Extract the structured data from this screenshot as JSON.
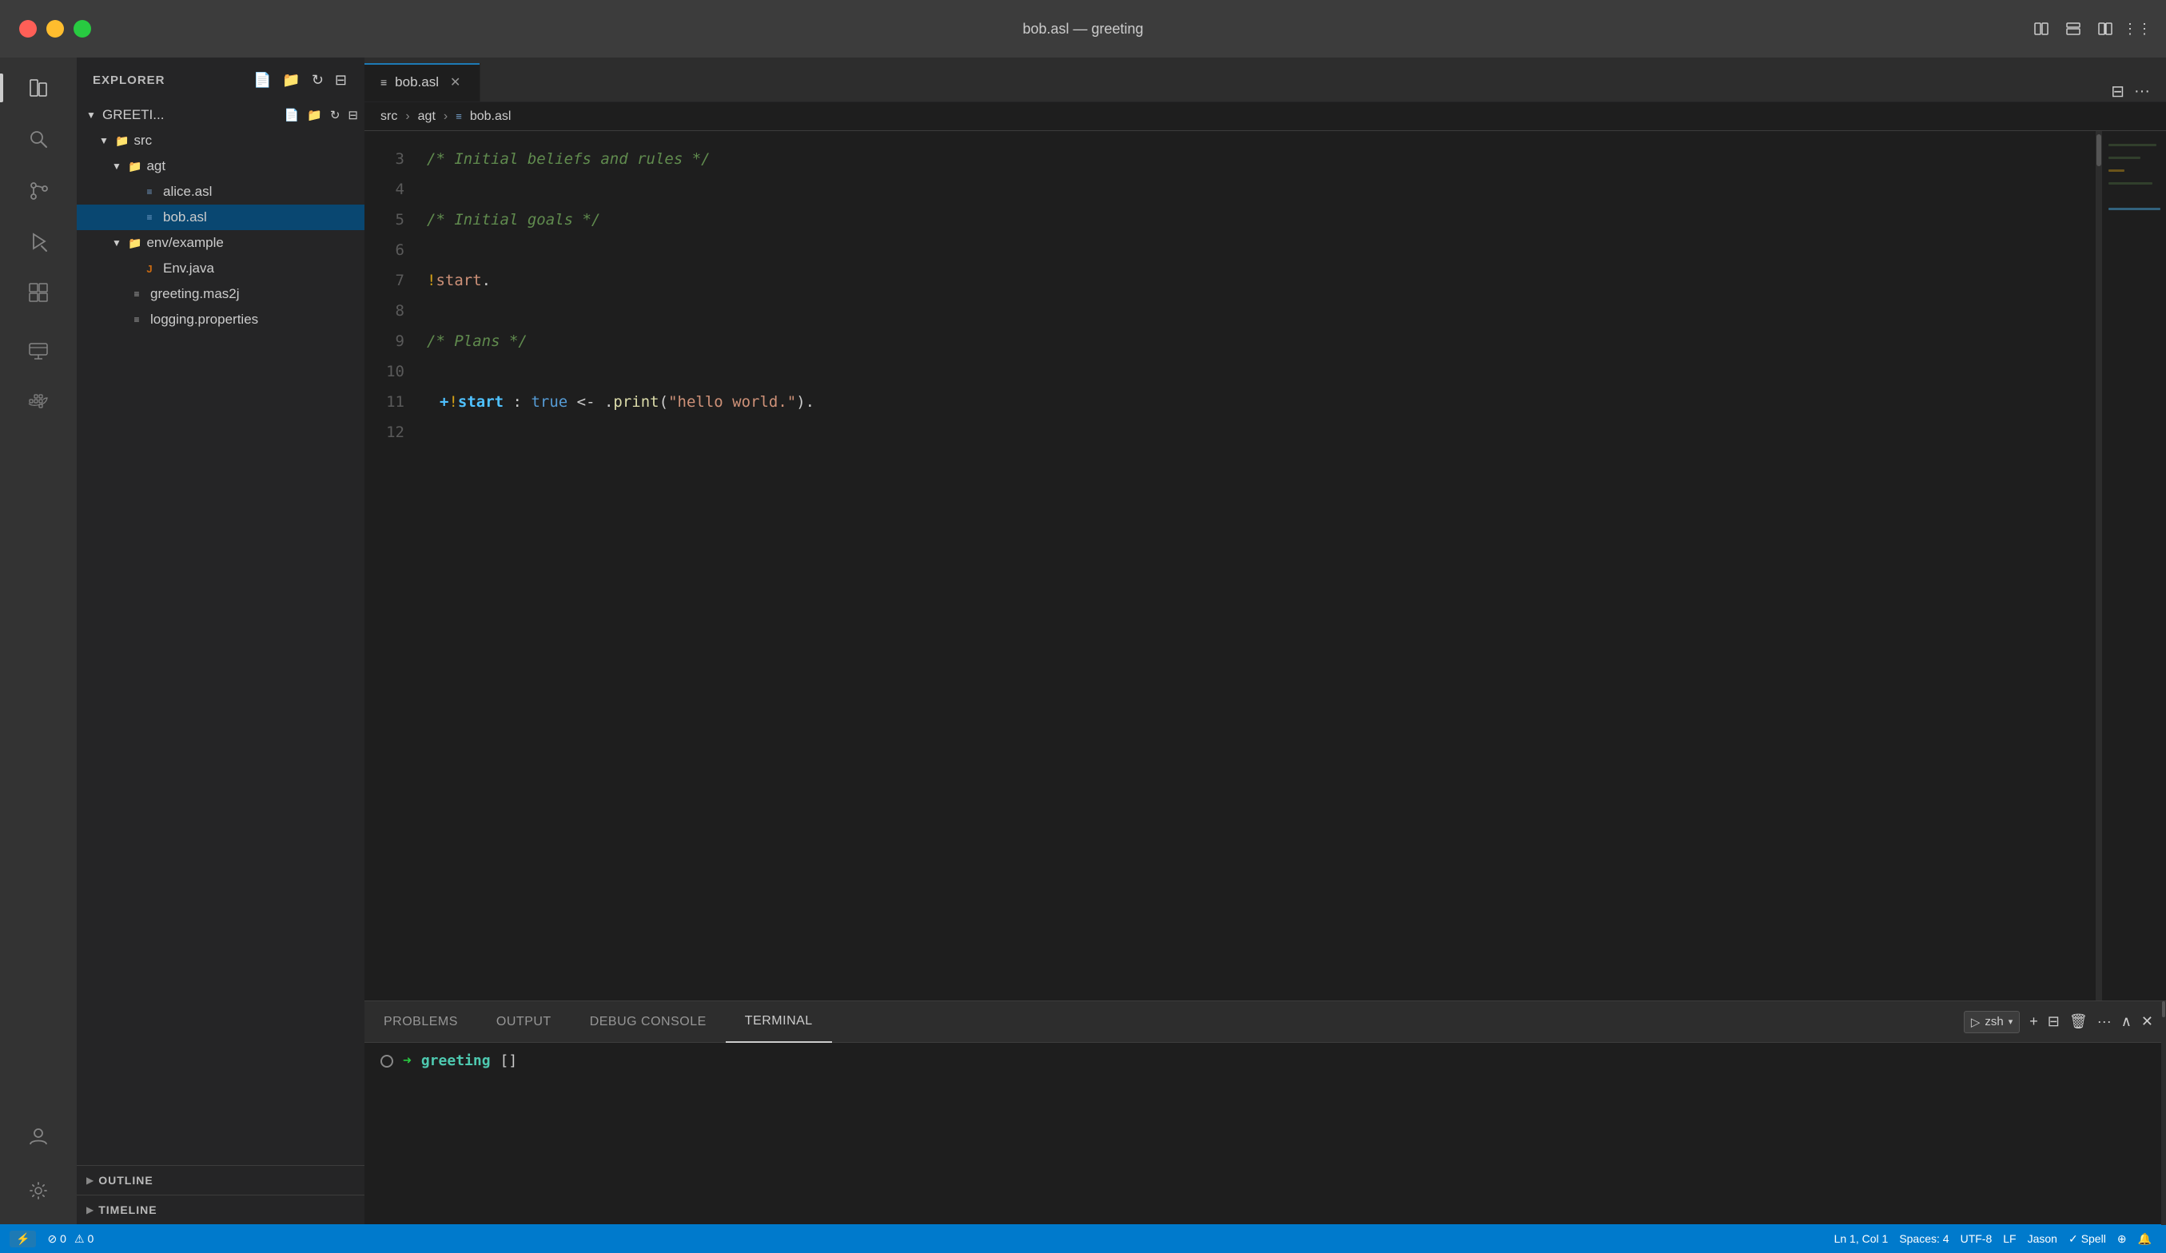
{
  "window": {
    "title": "bob.asl — greeting"
  },
  "titlebar": {
    "actions": [
      "layout-icon",
      "layout2-icon",
      "split-icon",
      "more-icon"
    ]
  },
  "activity_bar": {
    "items": [
      {
        "id": "explorer",
        "icon": "📄",
        "label": "Explorer",
        "active": true
      },
      {
        "id": "search",
        "icon": "🔍",
        "label": "Search",
        "active": false
      },
      {
        "id": "source-control",
        "icon": "⑂",
        "label": "Source Control",
        "active": false
      },
      {
        "id": "run",
        "icon": "▷",
        "label": "Run and Debug",
        "active": false
      },
      {
        "id": "extensions",
        "icon": "⊞",
        "label": "Extensions",
        "active": false
      },
      {
        "id": "remote",
        "icon": "🖥",
        "label": "Remote Explorer",
        "active": false
      },
      {
        "id": "docker",
        "icon": "🐳",
        "label": "Docker",
        "active": false
      }
    ],
    "bottom": [
      {
        "id": "accounts",
        "icon": "👤",
        "label": "Accounts"
      },
      {
        "id": "settings",
        "icon": "⚙",
        "label": "Settings"
      }
    ]
  },
  "sidebar": {
    "title": "EXPLORER",
    "header_actions": [
      "new-file",
      "new-folder",
      "refresh",
      "collapse"
    ],
    "tree": {
      "root": {
        "label": "GREETI...",
        "expanded": true,
        "children": [
          {
            "label": "src",
            "type": "folder",
            "expanded": true,
            "children": [
              {
                "label": "agt",
                "type": "folder",
                "expanded": true,
                "children": [
                  {
                    "label": "alice.asl",
                    "type": "asl"
                  },
                  {
                    "label": "bob.asl",
                    "type": "asl",
                    "selected": true
                  }
                ]
              },
              {
                "label": "env/example",
                "type": "folder",
                "expanded": true,
                "children": [
                  {
                    "label": "Env.java",
                    "type": "java"
                  }
                ]
              },
              {
                "label": "greeting.mas2j",
                "type": "mas2j"
              },
              {
                "label": "logging.properties",
                "type": "props"
              }
            ]
          }
        ]
      }
    },
    "panels": [
      {
        "label": "OUTLINE",
        "expanded": false
      },
      {
        "label": "TIMELINE",
        "expanded": false
      }
    ]
  },
  "tabs": [
    {
      "label": "bob.asl",
      "modified": true,
      "active": true,
      "path": "bob.asl"
    }
  ],
  "breadcrumb": {
    "items": [
      "src",
      "agt",
      "bob.asl"
    ]
  },
  "editor": {
    "lines": [
      {
        "num": "3",
        "tokens": [
          {
            "text": "/* Initial beliefs and rules */",
            "class": "c-comment"
          }
        ]
      },
      {
        "num": "4",
        "tokens": []
      },
      {
        "num": "5",
        "tokens": [
          {
            "text": "/* Initial goals */",
            "class": "c-comment"
          }
        ]
      },
      {
        "num": "6",
        "tokens": []
      },
      {
        "num": "7",
        "tokens": [
          {
            "text": "!",
            "class": "c-exclaim"
          },
          {
            "text": "start",
            "class": "c-goal"
          },
          {
            "text": ".",
            "class": "c-plain"
          }
        ]
      },
      {
        "num": "8",
        "tokens": []
      },
      {
        "num": "9",
        "tokens": [
          {
            "text": "/* Plans */",
            "class": "c-comment"
          }
        ]
      },
      {
        "num": "10",
        "tokens": []
      },
      {
        "num": "11",
        "tokens": [
          {
            "text": "+",
            "class": "c-plus"
          },
          {
            "text": "!",
            "class": "c-exclaim"
          },
          {
            "text": "start",
            "class": "c-start"
          },
          {
            "text": " : ",
            "class": "c-plain"
          },
          {
            "text": "true",
            "class": "c-bool"
          },
          {
            "text": " <- ",
            "class": "c-plain"
          },
          {
            "text": ".",
            "class": "c-plain"
          },
          {
            "text": "print",
            "class": "c-dot-method"
          },
          {
            "text": "(",
            "class": "c-plain"
          },
          {
            "text": "\"hello world.\"",
            "class": "c-string"
          },
          {
            "text": ").",
            "class": "c-plain"
          }
        ]
      },
      {
        "num": "12",
        "tokens": []
      }
    ]
  },
  "panel": {
    "tabs": [
      {
        "label": "PROBLEMS",
        "active": false
      },
      {
        "label": "OUTPUT",
        "active": false
      },
      {
        "label": "DEBUG CONSOLE",
        "active": false
      },
      {
        "label": "TERMINAL",
        "active": true
      }
    ],
    "terminal": {
      "shell": "zsh",
      "prompt_path": "greeting",
      "cursor": "[]"
    }
  },
  "status_bar": {
    "remote": "⚡",
    "errors": "0",
    "warnings": "0",
    "position": "Ln 1, Col 1",
    "spaces": "Spaces: 4",
    "encoding": "UTF-8",
    "line_ending": "LF",
    "user": "Jason",
    "spell": "Spell",
    "broadcast": "⊕",
    "notifications": "🔔"
  }
}
